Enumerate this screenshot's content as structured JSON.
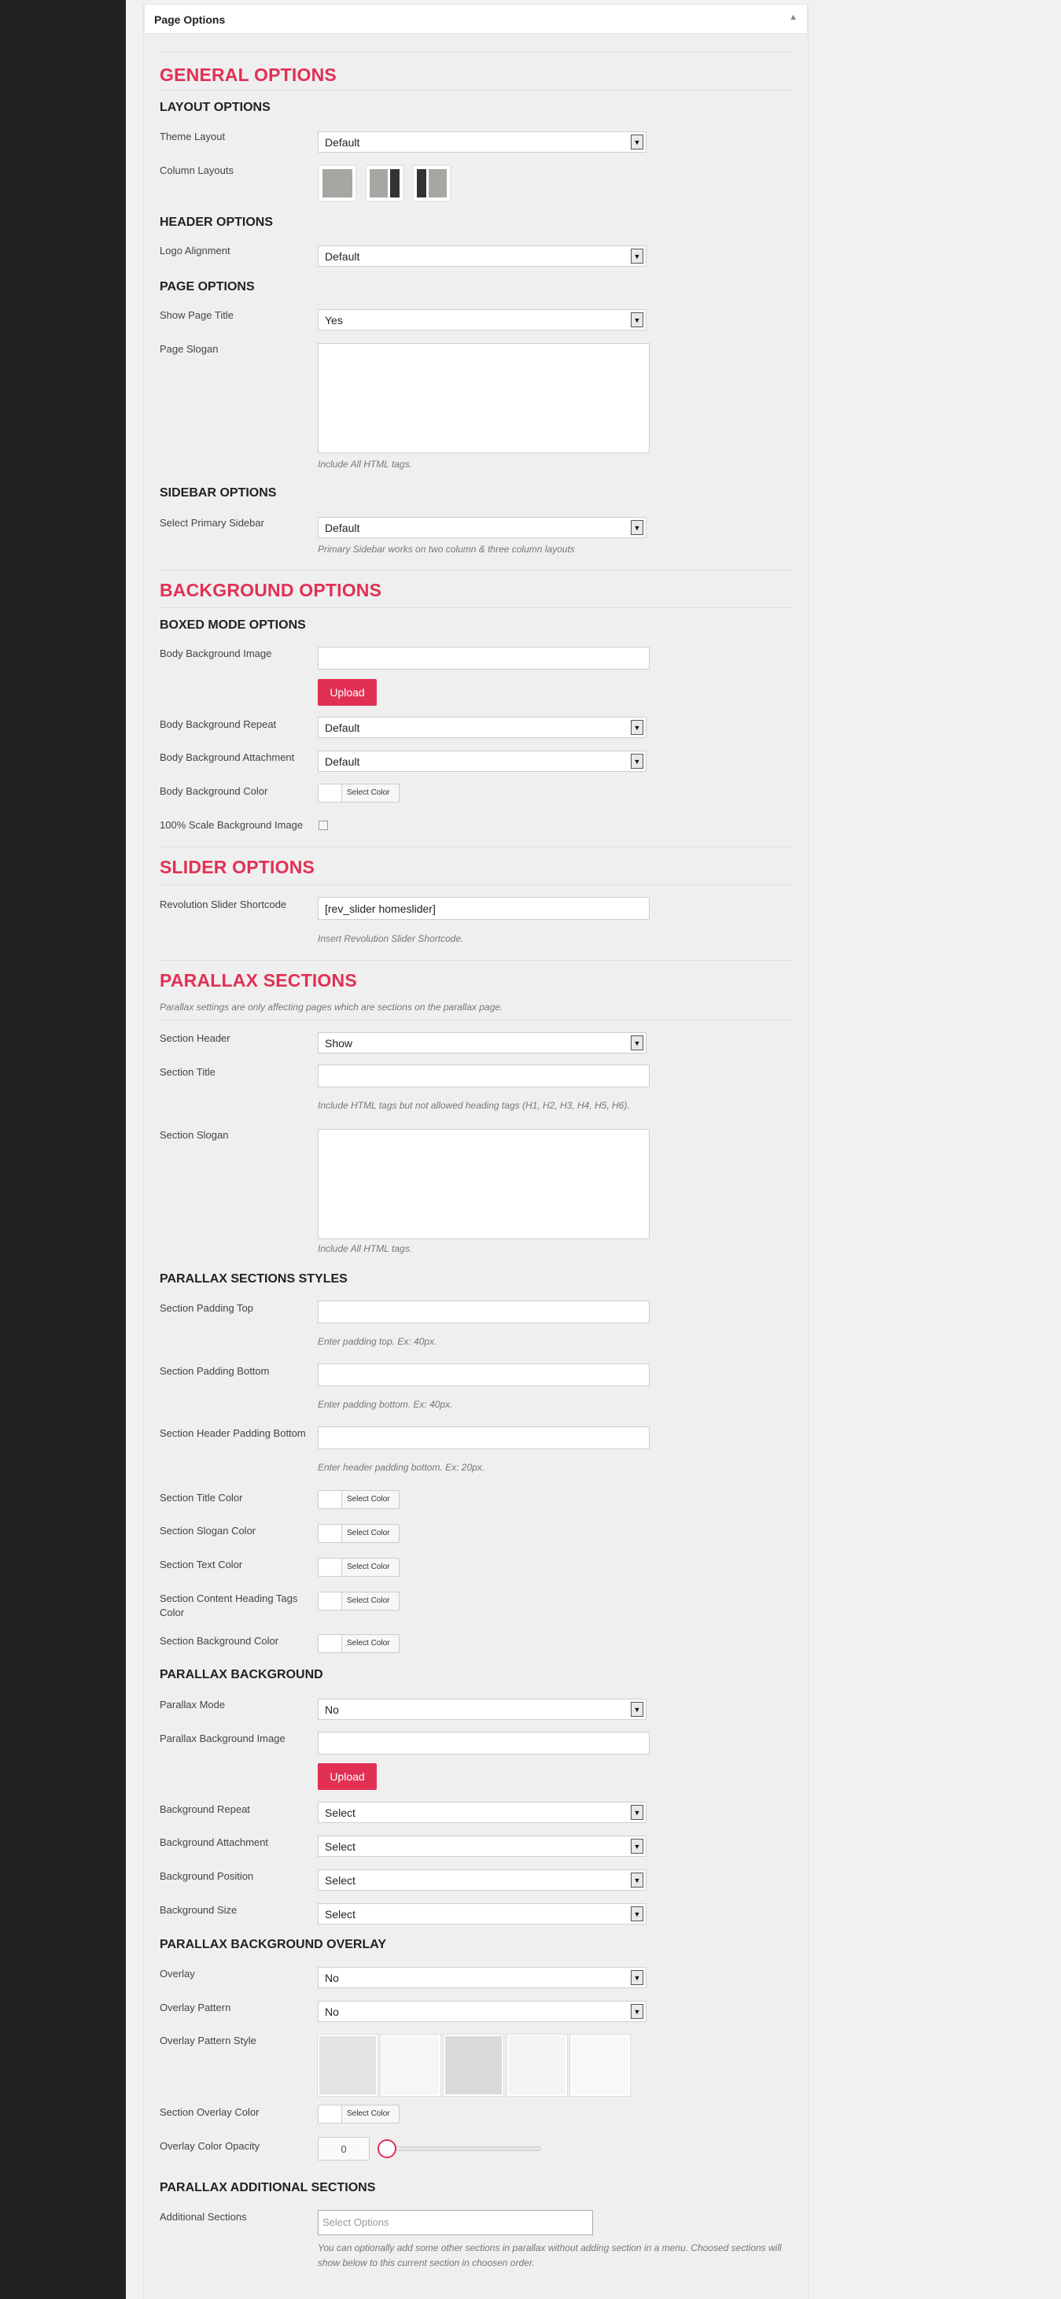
{
  "panel": {
    "title": "Page Options",
    "collapse_icon": "triangle-up-icon"
  },
  "general": {
    "title": "GENERAL OPTIONS",
    "layout_title": "LAYOUT OPTIONS",
    "theme_layout_label": "Theme Layout",
    "theme_layout_value": "Default",
    "column_layouts_label": "Column Layouts",
    "header_title": "HEADER OPTIONS",
    "logo_alignment_label": "Logo Alignment",
    "logo_alignment_value": "Default",
    "page_title": "PAGE OPTIONS",
    "show_page_title_label": "Show Page Title",
    "show_page_title_value": "Yes",
    "page_slogan_label": "Page Slogan",
    "page_slogan_hint": "Include All HTML tags.",
    "sidebar_title": "SIDEBAR OPTIONS",
    "primary_sidebar_label": "Select Primary Sidebar",
    "primary_sidebar_value": "Default",
    "primary_sidebar_hint": "Primary Sidebar works on two column & three column layouts"
  },
  "background": {
    "title": "BACKGROUND OPTIONS",
    "boxed_title": "BOXED MODE OPTIONS",
    "bg_image_label": "Body Background Image",
    "upload_label": "Upload",
    "bg_repeat_label": "Body Background Repeat",
    "bg_repeat_value": "Default",
    "bg_attach_label": "Body Background Attachment",
    "bg_attach_value": "Default",
    "bg_color_label": "Body Background Color",
    "select_color": "Select Color",
    "scale_label": "100% Scale Background Image"
  },
  "slider": {
    "title": "SLIDER OPTIONS",
    "shortcode_label": "Revolution Slider Shortcode",
    "shortcode_value": "[rev_slider homeslider]",
    "shortcode_hint": "Insert Revolution Slider Shortcode."
  },
  "parallax": {
    "title": "PARALLAX SECTIONS",
    "subtitle": "Parallax settings are only affecting pages which are sections on the parallax page.",
    "section_header_label": "Section Header",
    "section_header_value": "Show",
    "section_title_label": "Section Title",
    "section_title_hint": "Include HTML tags but not allowed heading tags (H1, H2, H3, H4, H5, H6).",
    "section_slogan_label": "Section Slogan",
    "section_slogan_hint": "Include All HTML tags.",
    "styles_title": "PARALLAX SECTIONS STYLES",
    "padding_top_label": "Section Padding Top",
    "padding_top_hint": "Enter padding top. Ex: 40px.",
    "padding_bottom_label": "Section Padding Bottom",
    "padding_bottom_hint": "Enter padding bottom. Ex: 40px.",
    "header_padding_label": "Section Header Padding Bottom",
    "header_padding_hint": "Enter header padding bottom. Ex: 20px.",
    "title_color_label": "Section Title Color",
    "slogan_color_label": "Section Slogan Color",
    "text_color_label": "Section Text Color",
    "heading_color_label": "Section Content Heading Tags Color",
    "bgcolor_label": "Section Background Color",
    "bg_title": "PARALLAX BACKGROUND",
    "mode_label": "Parallax Mode",
    "mode_value": "No",
    "bg_image_label": "Parallax Background Image",
    "repeat_label": "Background Repeat",
    "repeat_value": "Select",
    "attach_label": "Background Attachment",
    "attach_value": "Select",
    "position_label": "Background Position",
    "position_value": "Select",
    "size_label": "Background Size",
    "size_value": "Select",
    "overlay_title": "PARALLAX BACKGROUND OVERLAY",
    "overlay_label": "Overlay",
    "overlay_value": "No",
    "overlay_pattern_label": "Overlay Pattern",
    "overlay_pattern_value": "No",
    "overlay_style_label": "Overlay Pattern Style",
    "overlay_color_label": "Section Overlay Color",
    "opacity_label": "Overlay Color Opacity",
    "opacity_value": "0",
    "additional_title": "PARALLAX ADDITIONAL SECTIONS",
    "additional_label": "Additional Sections",
    "additional_placeholder": "Select Options",
    "additional_hint": "You can optionally add some other sections in parallax without adding section in a menu. Choosed sections will show below to this current section in choosen order."
  }
}
